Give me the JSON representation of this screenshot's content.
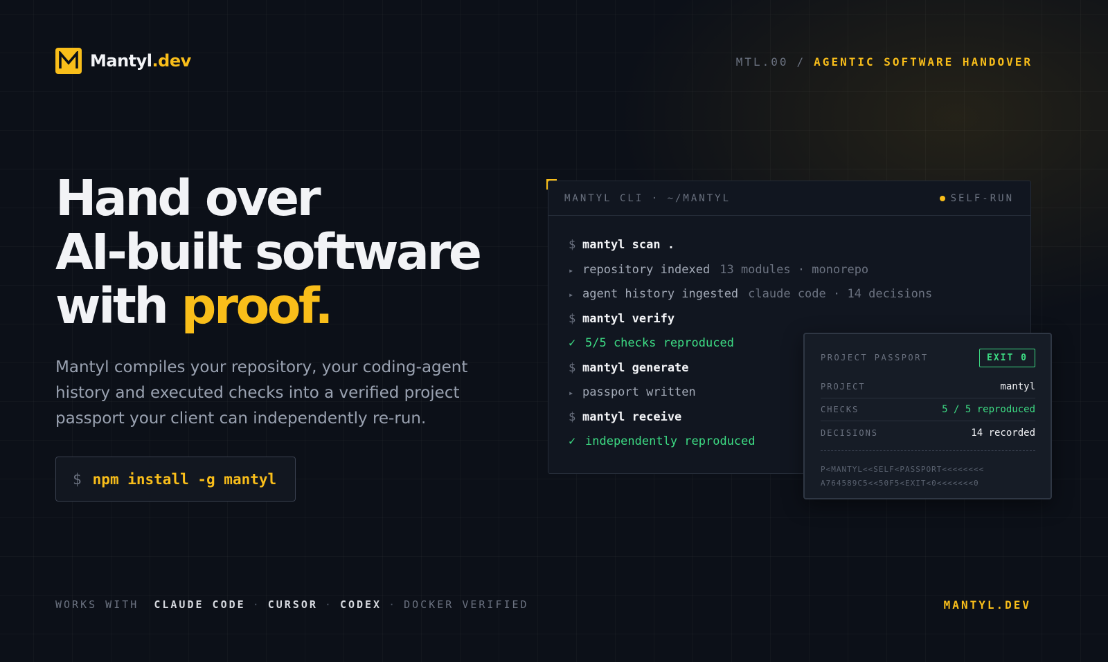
{
  "brand": {
    "name": "Mantyl",
    "tld": ".dev",
    "logo_letter": "M",
    "accent_color": "#f9be1a"
  },
  "header": {
    "code": "MTL.00",
    "separator": "/",
    "tagline": "AGENTIC SOFTWARE HANDOVER"
  },
  "hero": {
    "line1": "Hand over",
    "line2": "AI-built software",
    "line3_prefix": "with ",
    "line3_accent": "proof.",
    "subtitle": "Mantyl compiles your repository, your coding-agent history and executed checks into a verified project passport your client can independently re-run.",
    "install_prompt": "$",
    "install_command": "npm install -g mantyl"
  },
  "terminal": {
    "title": "MANTYL CLI · ~/MANTYL",
    "status": "SELF-RUN",
    "lines": [
      {
        "kind": "cmd",
        "prefix": "$",
        "text": "mantyl scan ."
      },
      {
        "kind": "info",
        "prefix": "▸",
        "text": "repository indexed",
        "meta": "13 modules · monorepo"
      },
      {
        "kind": "info",
        "prefix": "▸",
        "text": "agent history ingested",
        "meta": "claude code · 14 decisions"
      },
      {
        "kind": "cmd",
        "prefix": "$",
        "text": "mantyl verify"
      },
      {
        "kind": "ok",
        "prefix": "✓",
        "text": "5/5 checks reproduced"
      },
      {
        "kind": "cmd",
        "prefix": "$",
        "text": "mantyl generate"
      },
      {
        "kind": "info",
        "prefix": "▸",
        "text": "passport written"
      },
      {
        "kind": "cmd",
        "prefix": "$",
        "text": "mantyl receive"
      },
      {
        "kind": "ok",
        "prefix": "✓",
        "text": "independently reproduced"
      }
    ]
  },
  "passport": {
    "title": "PROJECT PASSPORT",
    "exit_badge": "EXIT 0",
    "rows": [
      {
        "key": "PROJECT",
        "value": "mantyl",
        "ok": false
      },
      {
        "key": "CHECKS",
        "value": "5 / 5 reproduced",
        "ok": true
      },
      {
        "key": "DECISIONS",
        "value": "14 recorded",
        "ok": false
      }
    ],
    "mrz_line1": "P<MANTYL<<SELF<PASSPORT<<<<<<<<",
    "mrz_line2": "A764589C5<<50F5<EXIT<0<<<<<<<0"
  },
  "footer": {
    "works_with": "WORKS WITH",
    "tools": [
      "CLAUDE CODE",
      "CURSOR",
      "CODEX"
    ],
    "extra": "DOCKER VERIFIED",
    "separator": "·",
    "site": "MANTYL.DEV"
  }
}
